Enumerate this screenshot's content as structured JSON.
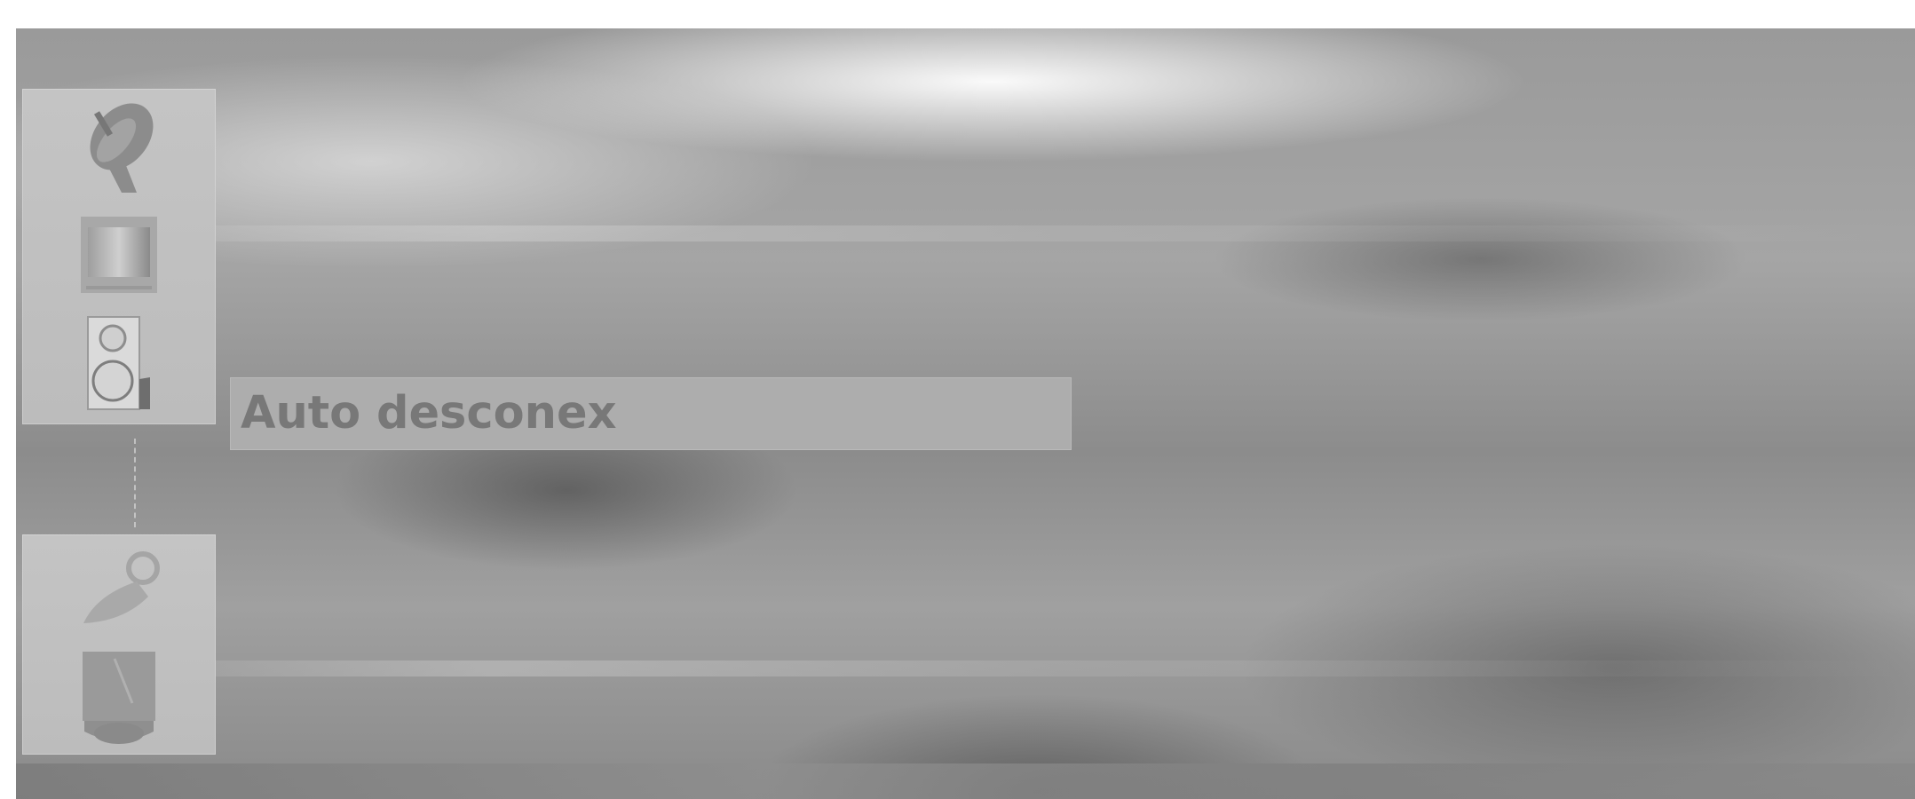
{
  "menu": {
    "icons": [
      {
        "name": "satellite-dish-icon",
        "selected": false
      },
      {
        "name": "picture-icon",
        "selected": false
      },
      {
        "name": "speaker-icon",
        "selected": true
      },
      {
        "name": "clock-icon",
        "selected": false
      },
      {
        "name": "lock-icon",
        "selected": false
      }
    ],
    "selected_item": {
      "label": "Auto desconex"
    }
  },
  "colors": {
    "panel": "#c0c0c0",
    "highlight": "#adadad",
    "label_text": "#787878"
  }
}
